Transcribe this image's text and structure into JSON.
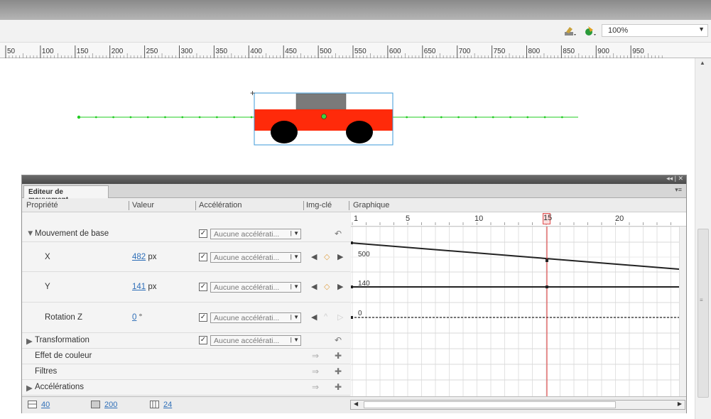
{
  "toolbar": {
    "zoom_value": "100%",
    "icons": [
      "edit-scene-icon",
      "edit-symbols-icon"
    ]
  },
  "ruler": {
    "labels": [
      "50",
      "100",
      "150",
      "200",
      "250",
      "300",
      "350",
      "400",
      "450",
      "500",
      "550",
      "600",
      "650",
      "700",
      "750",
      "800",
      "850",
      "900",
      "950"
    ]
  },
  "panel": {
    "tab_label": "Editeur de mouvement",
    "columns": {
      "property": "Propriété",
      "value": "Valeur",
      "ease": "Accélération",
      "keyframe": "Img-clé",
      "graph": "Graphique"
    },
    "frame_numbers": [
      "1",
      "5",
      "10",
      "15",
      "20"
    ],
    "current_frame": "15",
    "rows": {
      "basic_motion": {
        "label": "Mouvement de base",
        "ease": "Aucune accélérati..."
      },
      "x": {
        "label": "X",
        "value": "482",
        "unit": "px",
        "ease": "Aucune accélérati...",
        "graph_label": "500"
      },
      "y": {
        "label": "Y",
        "value": "141",
        "unit": "px",
        "ease": "Aucune accélérati...",
        "graph_label": "140"
      },
      "rotation": {
        "label": "Rotation Z",
        "value": "0",
        "unit": "°",
        "ease": "Aucune accélérati...",
        "graph_label": "0"
      },
      "transformation": {
        "label": "Transformation",
        "ease": "Aucune accélérati..."
      },
      "color_effect": {
        "label": "Effet de couleur"
      },
      "filters": {
        "label": "Filtres"
      },
      "eases": {
        "label": "Accélérations"
      }
    },
    "footer": {
      "graph_size": "40",
      "expanded_graph_size": "200",
      "visible_frames": "24"
    }
  },
  "colors": {
    "car_body": "#ff2a0a",
    "car_roof": "#7a7a7a",
    "path": "#22cc22",
    "selection": "#3d9ad8",
    "playhead": "#e03030",
    "link": "#2f6fb8"
  }
}
